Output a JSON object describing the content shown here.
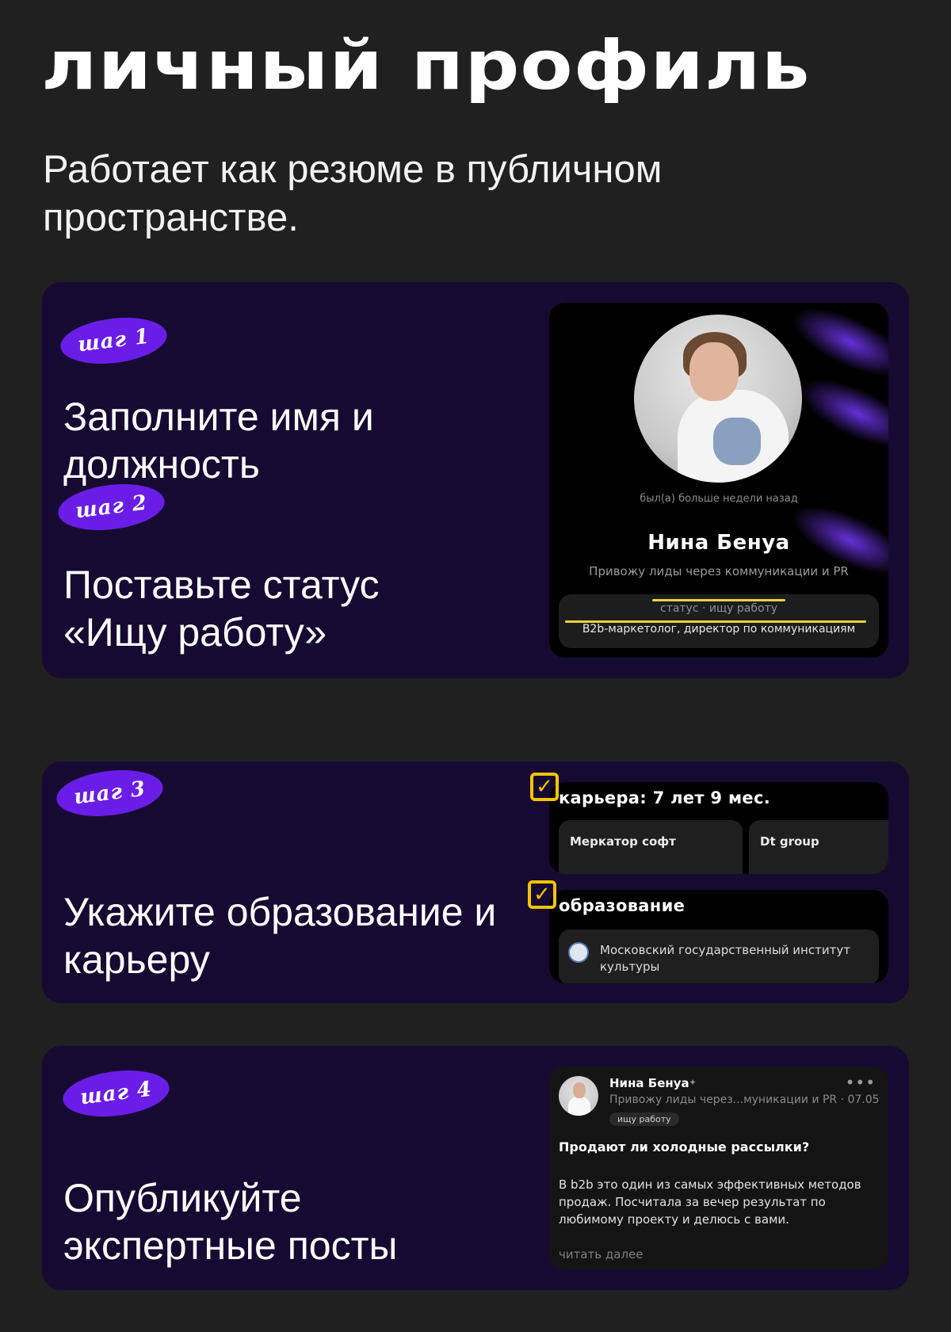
{
  "header": {
    "title": "личный профиль",
    "subtitle": "Работает как резюме в публичном пространстве."
  },
  "steps": [
    {
      "badge": "шаг 1",
      "text": "Заполните имя и должность"
    },
    {
      "badge": "шаг 2",
      "text": "Поставьте статус «Ищу работу»"
    },
    {
      "badge": "шаг 3",
      "text": "Укажите образование и карьеру"
    },
    {
      "badge": "шаг 4",
      "text": "Опубликуйте экспертные посты"
    }
  ],
  "profile": {
    "last_seen": "был(а) больше недели назад",
    "name": "Нина Бенуа",
    "role": "Привожу лиды через коммуникации и PR",
    "status_label": "статус · ищу работу",
    "status_value": "B2b-маркетолог, директор по коммуникациям"
  },
  "career": {
    "title": "карьера: 7 лет 9 мес.",
    "jobs": [
      "Меркатор софт",
      "Dt group"
    ]
  },
  "education": {
    "title": "образование",
    "institution": "Московский государственный институт культуры"
  },
  "post": {
    "author": "Нина Бенуа",
    "meta": "Привожу лиды через...муникации и PR · 07.05",
    "tag": "ищу работу",
    "title": "Продают ли холодные рассылки?",
    "body": "В b2b это один из самых эффективных методов продаж. Посчитала за вечер результат по любимому проекту и делюсь с вами.",
    "read_more": "читать далее"
  },
  "icons": {
    "check": "✓",
    "pin": "✦",
    "more": "•••"
  },
  "colors": {
    "background": "#202020",
    "card": "#160a33",
    "badge": "#6a1de6",
    "highlight": "#f1d13a"
  }
}
